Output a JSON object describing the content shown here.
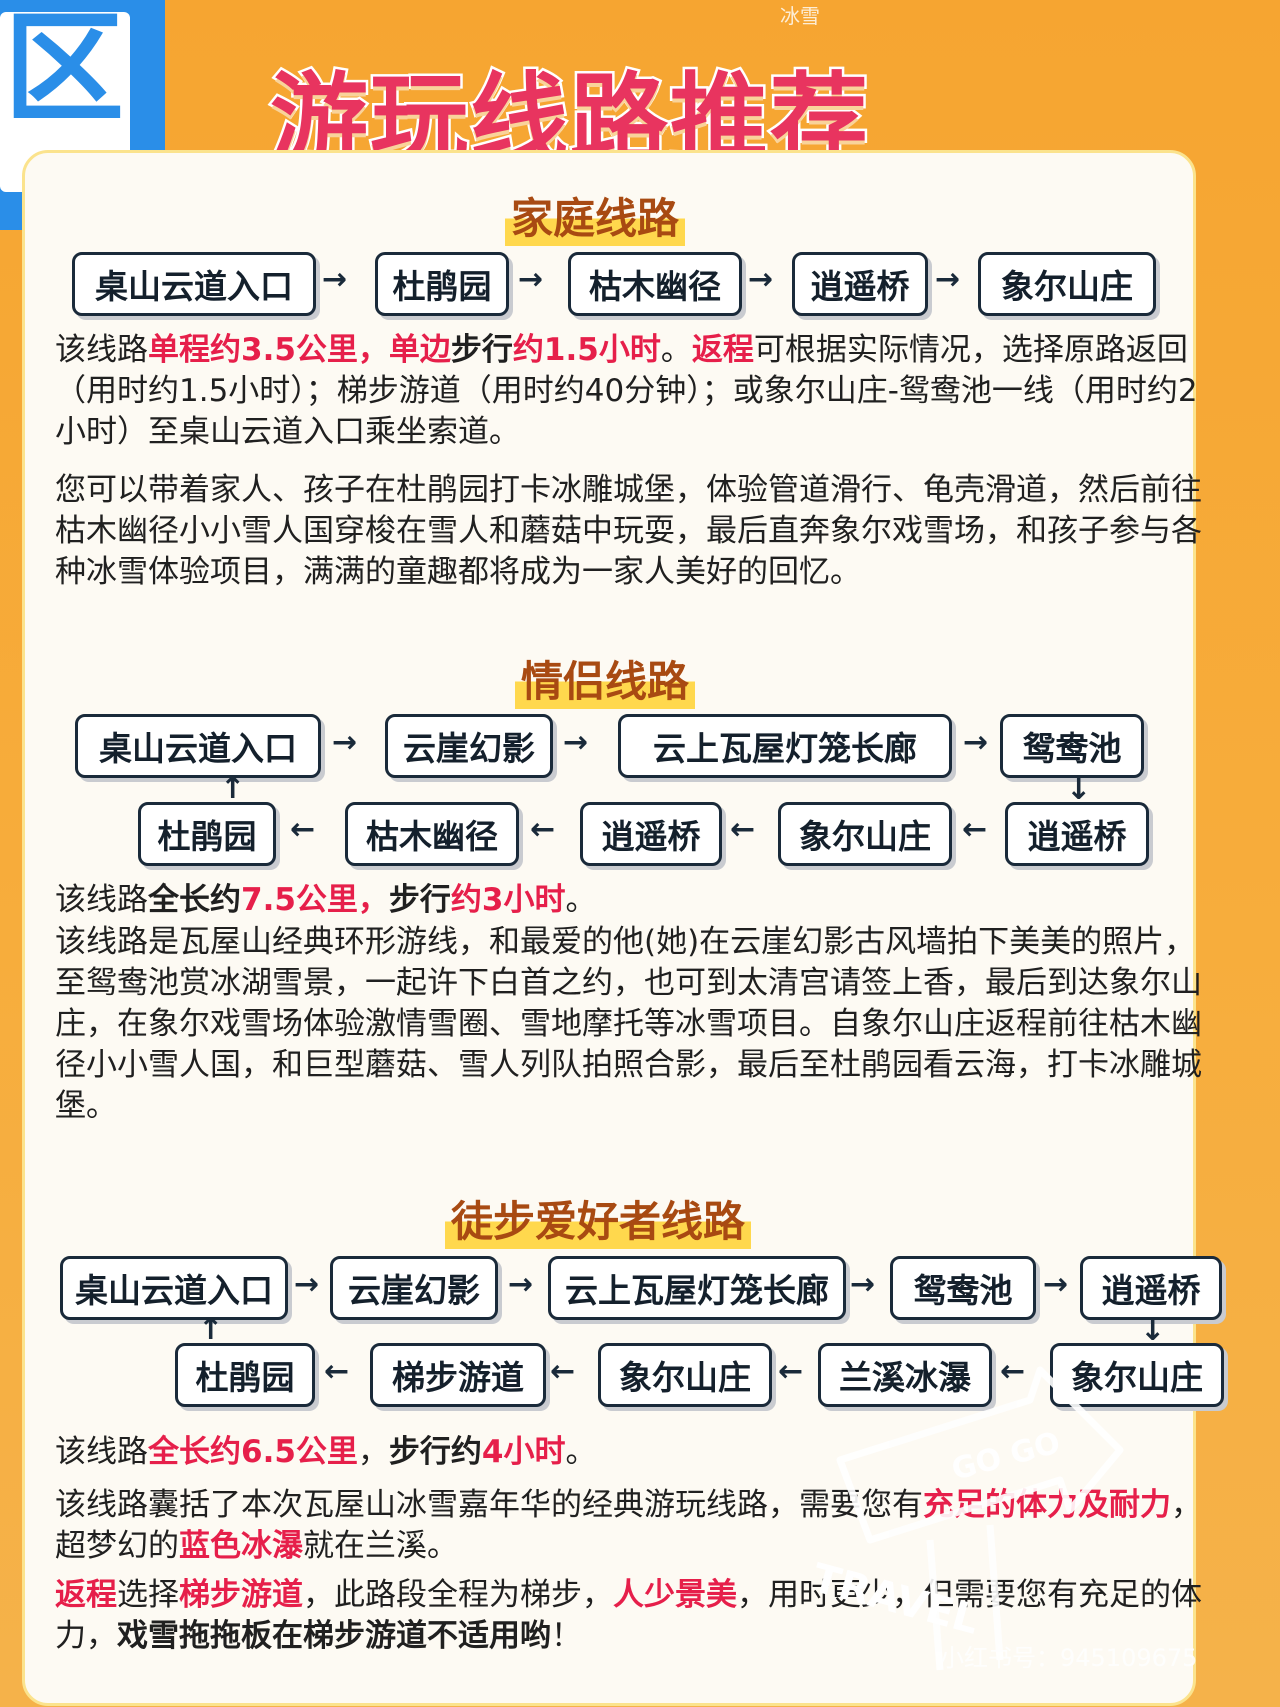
{
  "header": {
    "title": "游玩线路推荐",
    "top_fragment": "冰雪",
    "sign_glyph": "区"
  },
  "family": {
    "title": "家庭线路",
    "route": [
      "桌山云道入口",
      "杜鹃园",
      "枯木幽径",
      "逍遥桥",
      "象尔山庄"
    ],
    "summary": [
      {
        "t": "该线路",
        "s": ""
      },
      {
        "t": "单程约3.5公里，单边",
        "s": "r"
      },
      {
        "t": "步行",
        "s": "b"
      },
      {
        "t": "约1.5小时",
        "s": "r"
      },
      {
        "t": "。",
        "s": ""
      },
      {
        "t": "返程",
        "s": "r"
      },
      {
        "t": "可根据实际情况，选择原路返回（用时约1.5小时）；梯步游道（用时约40分钟）；或象尔山庄-鸳鸯池一线（用时约2小时）至桌山云道入口乘坐索道。",
        "s": ""
      }
    ],
    "description": "您可以带着家人、孩子在杜鹃园打卡冰雕城堡，体验管道滑行、龟壳滑道，然后前往枯木幽径小小雪人国穿梭在雪人和蘑菇中玩耍，最后直奔象尔戏雪场，和孩子参与各种冰雪体验项目，满满的童趣都将成为一家人美好的回忆。"
  },
  "couple": {
    "title": "情侣线路",
    "route_top": [
      "桌山云道入口",
      "云崖幻影",
      "云上瓦屋灯笼长廊",
      "鸳鸯池"
    ],
    "route_bottom": [
      "杜鹃园",
      "枯木幽径",
      "逍遥桥",
      "象尔山庄",
      "逍遥桥"
    ],
    "summary": [
      {
        "t": "该线路",
        "s": ""
      },
      {
        "t": "全长约",
        "s": "b"
      },
      {
        "t": "7.5公里，",
        "s": "r"
      },
      {
        "t": "步行",
        "s": "b"
      },
      {
        "t": "约3小时",
        "s": "r"
      },
      {
        "t": "。",
        "s": ""
      }
    ],
    "description": "该线路是瓦屋山经典环形游线，和最爱的他(她)在云崖幻影古风墙拍下美美的照片，至鸳鸯池赏冰湖雪景，一起许下白首之约，也可到太清宫请签上香，最后到达象尔山庄，在象尔戏雪场体验激情雪圈、雪地摩托等冰雪项目。自象尔山庄返程前往枯木幽径小小雪人国，和巨型蘑菇、雪人列队拍照合影，最后至杜鹃园看云海，打卡冰雕城堡。"
  },
  "hiking": {
    "title": "徒步爱好者线路",
    "route_top": [
      "桌山云道入口",
      "云崖幻影",
      "云上瓦屋灯笼长廊",
      "鸳鸯池",
      "逍遥桥"
    ],
    "route_bottom": [
      "杜鹃园",
      "梯步游道",
      "象尔山庄",
      "兰溪冰瀑",
      "象尔山庄"
    ],
    "summary": [
      {
        "t": "该线路",
        "s": ""
      },
      {
        "t": "全长约6.5公里",
        "s": "r"
      },
      {
        "t": "，",
        "s": ""
      },
      {
        "t": "步行约",
        "s": "b"
      },
      {
        "t": "4小时",
        "s": "r"
      },
      {
        "t": "。",
        "s": ""
      }
    ],
    "desc1": [
      {
        "t": "该线路囊括了本次瓦屋山冰雪嘉年华的经典游玩线路，需要您有",
        "s": ""
      },
      {
        "t": "充足的体力及耐力",
        "s": "r"
      },
      {
        "t": "，超梦幻的",
        "s": ""
      },
      {
        "t": "蓝色冰瀑",
        "s": "r"
      },
      {
        "t": "就在兰溪。",
        "s": ""
      }
    ],
    "desc2": [
      {
        "t": "返程",
        "s": "r"
      },
      {
        "t": "选择",
        "s": ""
      },
      {
        "t": "梯步游道",
        "s": "r"
      },
      {
        "t": "，此路段全程为梯步，",
        "s": ""
      },
      {
        "t": "人少景美",
        "s": "r"
      },
      {
        "t": "，用时更少，但需要您有充足的体力，",
        "s": ""
      },
      {
        "t": "戏雪拖拖板在梯步游道不适用哟",
        "s": "b"
      },
      {
        "t": "！",
        "s": ""
      }
    ]
  },
  "watermark": {
    "text": "小红书号：945109675",
    "stamp_top": "GO GO",
    "stamp_bottom": "TRAVEL"
  },
  "colors": {
    "accent": "#e61f4a",
    "title": "#e8345f",
    "section": "#a84a12",
    "highlight": "#ffd84d",
    "background": "#f6a531"
  }
}
